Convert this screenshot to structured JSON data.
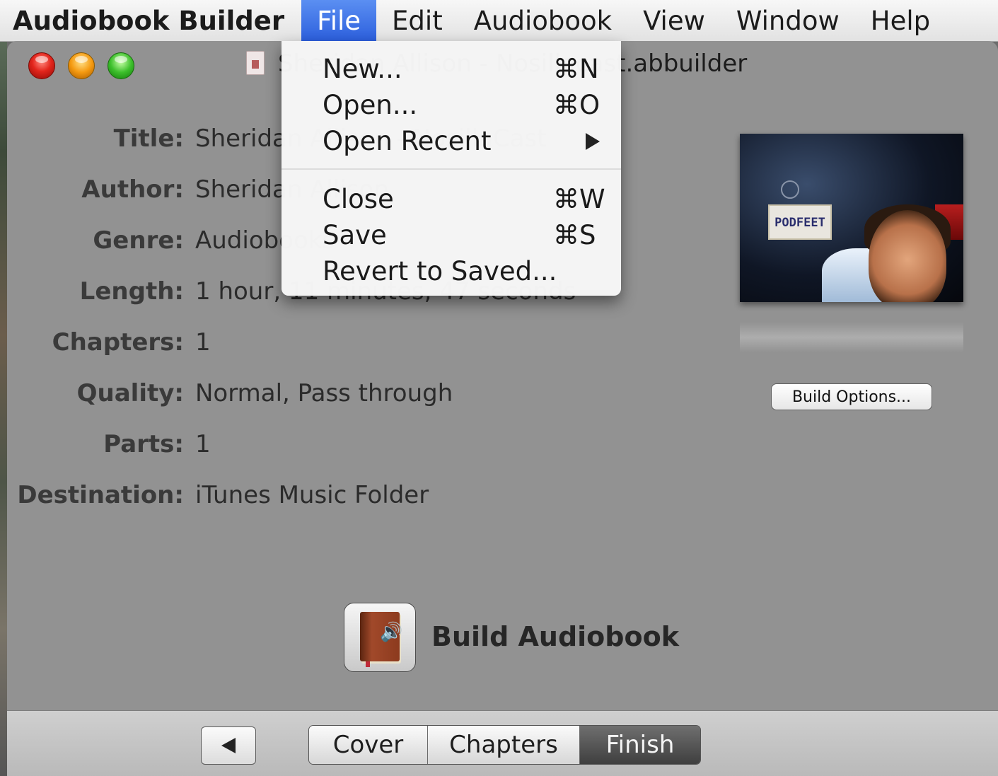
{
  "menubar": {
    "app_name": "Audiobook Builder",
    "items": [
      "File",
      "Edit",
      "Audiobook",
      "View",
      "Window",
      "Help"
    ],
    "active": "File"
  },
  "window": {
    "title": "Sheridan Allison - Nosillacast.abbuilder",
    "visible_title_fragment_left": "S",
    "visible_title_fragment_right": "st.abbuilder"
  },
  "info": [
    {
      "label": "Title:",
      "value": "Sheridan Allison - NosillaCast"
    },
    {
      "label": "Author:",
      "value": "Sheridan Allison"
    },
    {
      "label": "Genre:",
      "value": "Audiobooks"
    },
    {
      "label": "Length:",
      "value": "1 hour, 11 minutes, 47 seconds"
    },
    {
      "label": "Chapters:",
      "value": "1"
    },
    {
      "label": "Quality:",
      "value": "Normal, Pass through"
    },
    {
      "label": "Parts:",
      "value": "1"
    },
    {
      "label": "Destination:",
      "value": "iTunes Music Folder"
    }
  ],
  "cover": {
    "plate_text": "PODFEET"
  },
  "buttons": {
    "build_options": "Build Options...",
    "build_audiobook": "Build Audiobook"
  },
  "bottom": {
    "tabs": [
      "Cover",
      "Chapters",
      "Finish"
    ],
    "selected_tab": "Finish"
  },
  "file_menu": {
    "items": [
      {
        "label": "New...",
        "shortcut": "⌘N"
      },
      {
        "label": "Open...",
        "shortcut": "⌘O"
      },
      {
        "label": "Open Recent",
        "shortcut": ""
      },
      {
        "label": "Close",
        "shortcut": "⌘W"
      },
      {
        "label": "Save",
        "shortcut": "⌘S"
      },
      {
        "label": "Revert to Saved...",
        "shortcut": ""
      }
    ]
  }
}
